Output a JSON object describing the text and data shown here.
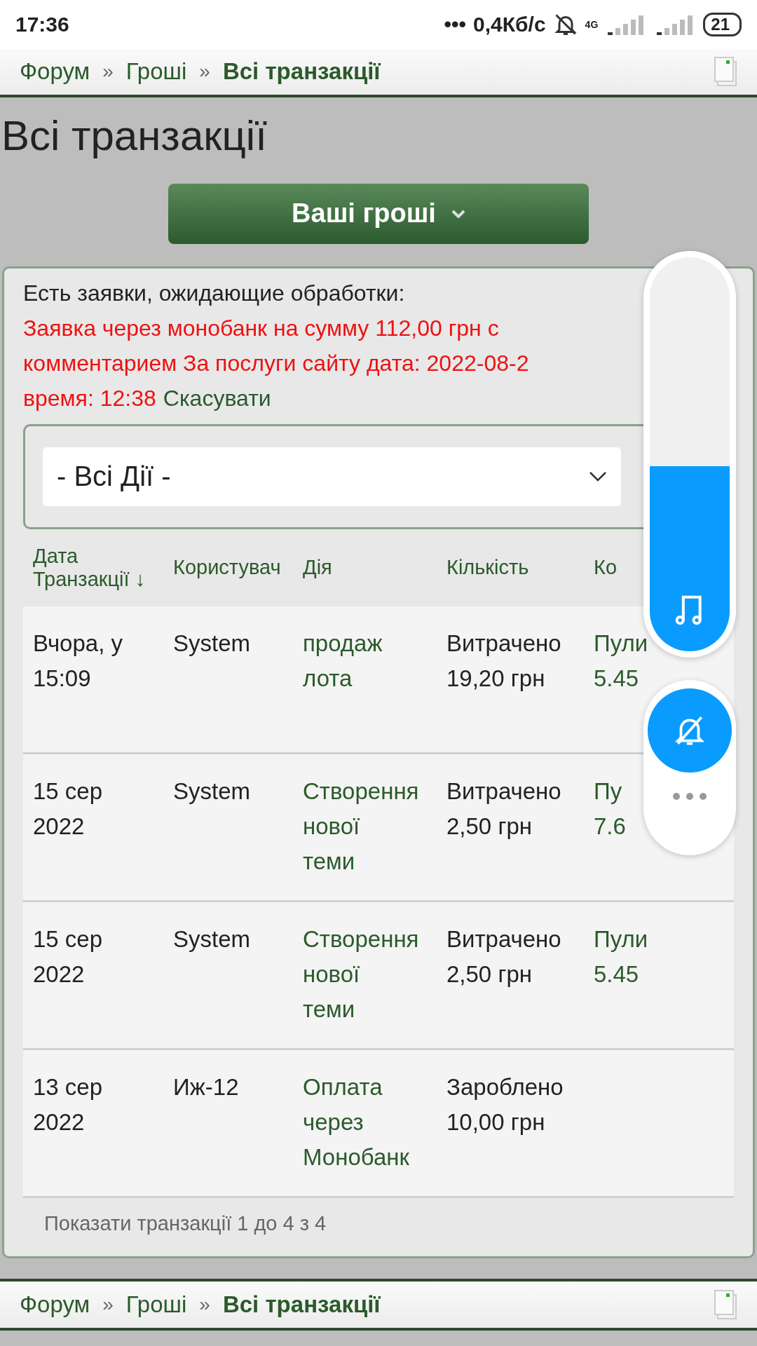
{
  "status_bar": {
    "time": "17:36",
    "dots": "•••",
    "speed": "0,4Кб/с",
    "network": "4G",
    "battery": "21"
  },
  "breadcrumb_top": {
    "items": [
      {
        "label": "Форум",
        "current": false
      },
      {
        "label": "Гроші",
        "current": false
      },
      {
        "label": "Всі транзакції",
        "current": true
      }
    ],
    "separator": "»"
  },
  "page_title": "Всі транзакції",
  "money_button": "Ваші гроші",
  "pending": {
    "heading": "Есть заявки, ожидающие обработки:",
    "lines": [
      "Заявка через монобанк на сумму 112,00 грн с",
      "комментарием За послуги сайту дата: 2022-08-2",
      "время: 12:38"
    ],
    "cancel_link": "Скасувати"
  },
  "filter": {
    "value": "- Всі Дії -"
  },
  "table": {
    "columns": [
      {
        "label": "Дата Транзакції",
        "sort": "↓"
      },
      {
        "label": "Користувач"
      },
      {
        "label": "Дія"
      },
      {
        "label": "Кількість"
      },
      {
        "label": "Ко"
      }
    ],
    "rows": [
      {
        "date": [
          "Вчора, у",
          "15:09"
        ],
        "user": "System",
        "action": [
          "продаж",
          "лота"
        ],
        "amount": [
          "Витрачено",
          "19,20 грн"
        ],
        "column_5": [
          "Пули",
          "5.45"
        ]
      },
      {
        "date": [
          "15 сер",
          "2022"
        ],
        "user": "System",
        "action": [
          "Створення",
          "нової",
          "теми"
        ],
        "amount": [
          "Витрачено",
          "2,50 грн"
        ],
        "column_5": [
          "Пу",
          "7.6"
        ]
      },
      {
        "date": [
          "15 сер",
          "2022"
        ],
        "user": "System",
        "action": [
          "Створення",
          "нової",
          "теми"
        ],
        "amount": [
          "Витрачено",
          "2,50 грн"
        ],
        "column_5": [
          "Пули",
          "5.45"
        ]
      },
      {
        "date": [
          "13 сер",
          "2022"
        ],
        "user": "Иж-12",
        "action": [
          "Оплата",
          "через",
          "Монобанк"
        ],
        "amount": [
          "Зароблено",
          "10,00 грн"
        ]
      }
    ],
    "footer": "Показати транзакції 1 до 4 з 4"
  },
  "breadcrumb_bottom": {
    "items": [
      {
        "label": "Форум",
        "current": false
      },
      {
        "label": "Гроші",
        "current": false
      },
      {
        "label": "Всі транзакції",
        "current": true
      }
    ],
    "separator": "»"
  },
  "volume_overlay": {
    "level": 0.47
  }
}
